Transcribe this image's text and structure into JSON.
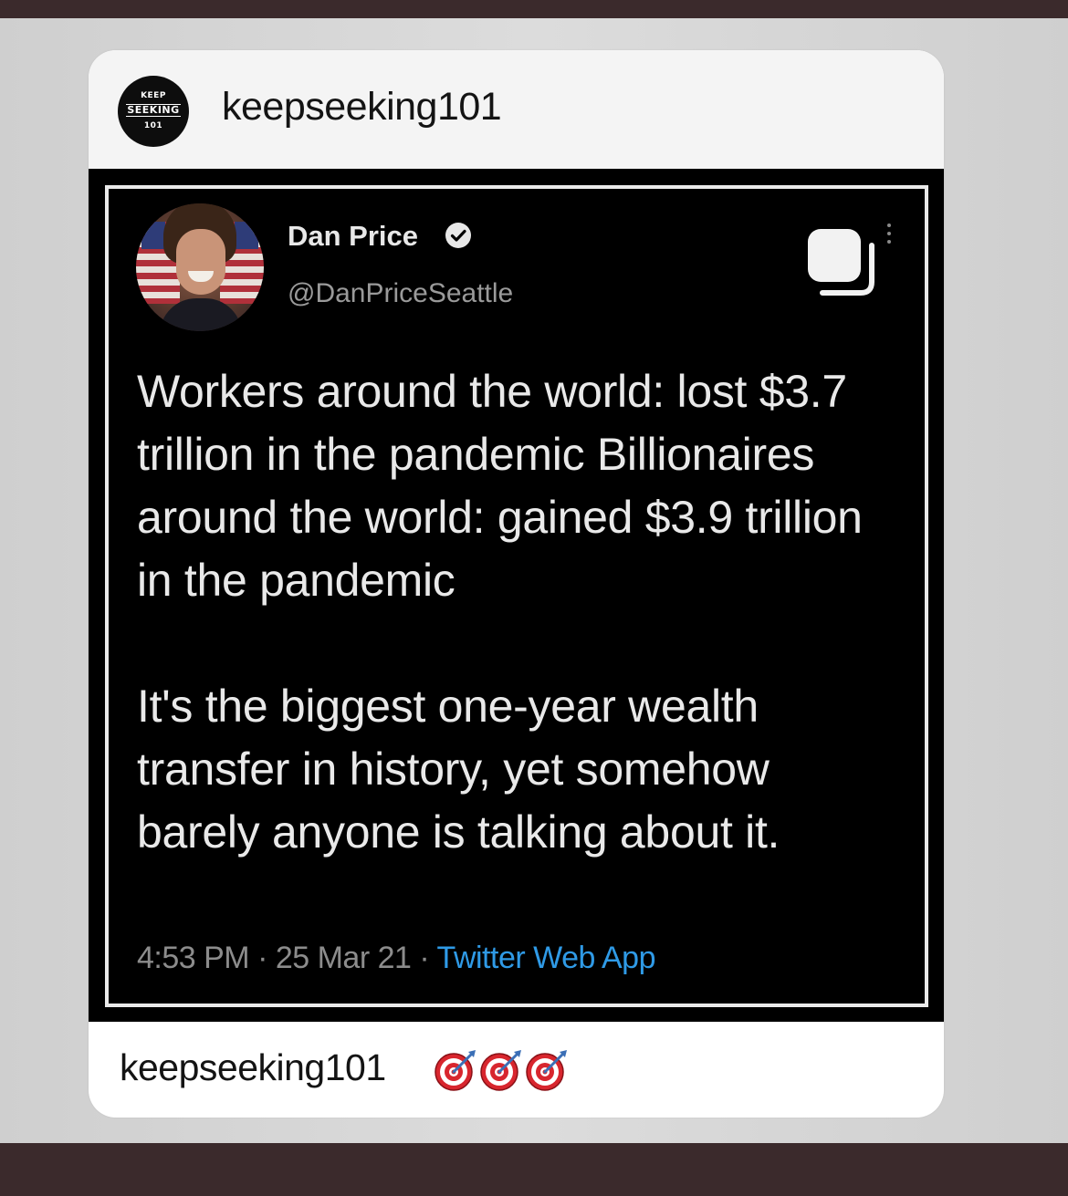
{
  "post": {
    "header_username": "keepseeking101",
    "avatar_logo": {
      "line1": "KEEP",
      "line2": "SEEKING",
      "line3": "101"
    },
    "caption_username": "keepseeking101",
    "caption_emojis": [
      "target-icon",
      "target-icon",
      "target-icon"
    ]
  },
  "tweet": {
    "display_name": "Dan Price",
    "handle": "@DanPriceSeattle",
    "verified": true,
    "body_paragraphs": [
      "Workers around the world: lost $3.7 trillion in the pandemic Billionaires around the world: gained $3.9 trillion in the pandemic",
      "It's the biggest one-year wealth transfer in history, yet somehow barely anyone is talking about it."
    ],
    "time": "4:53 PM",
    "date": "25 Mar 21",
    "source": "Twitter Web App",
    "separator": " · "
  },
  "colors": {
    "tweet_bg": "#000000",
    "tweet_text": "#e9e9e9",
    "link_blue": "#2f9ae6",
    "frame": "#eaeaea",
    "backdrop": "#3b2a2c"
  }
}
